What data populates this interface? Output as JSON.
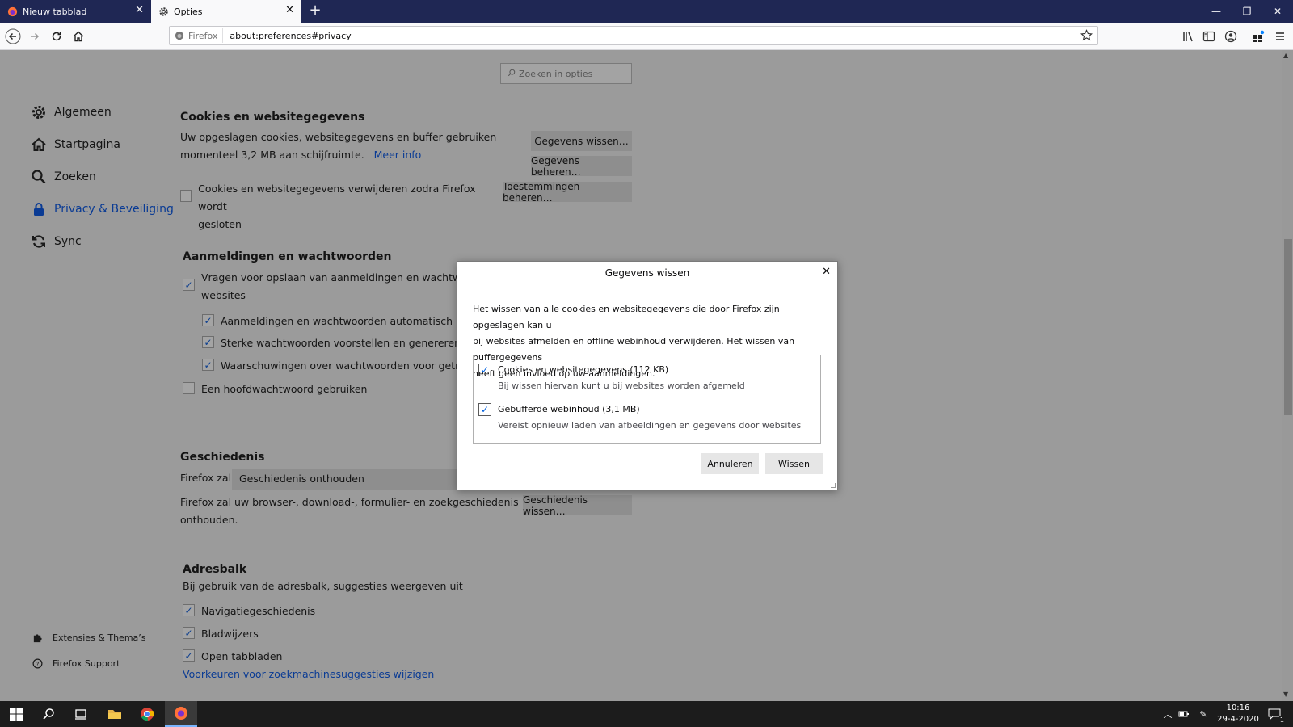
{
  "browser": {
    "tabs": [
      {
        "label": "Nieuw tabblad",
        "icon": "firefox-icon"
      },
      {
        "label": "Opties",
        "icon": "gear-icon"
      }
    ],
    "url_identity": "Firefox",
    "url": "about:preferences#privacy"
  },
  "sidebar": {
    "items": [
      {
        "label": "Algemeen",
        "icon": "gear-icon"
      },
      {
        "label": "Startpagina",
        "icon": "home-icon"
      },
      {
        "label": "Zoeken",
        "icon": "search-icon"
      },
      {
        "label": "Privacy & Beveiliging",
        "icon": "lock-icon",
        "active": true
      },
      {
        "label": "Sync",
        "icon": "sync-icon"
      }
    ],
    "footer": [
      {
        "label": "Extensies & Thema’s",
        "icon": "puzzle-icon"
      },
      {
        "label": "Firefox Support",
        "icon": "help-icon"
      }
    ]
  },
  "search": {
    "placeholder": "Zoeken in opties"
  },
  "cookies": {
    "title": "Cookies en websitegegevens",
    "desc_line1": "Uw opgeslagen cookies, websitegegevens en buffer gebruiken",
    "desc_line2": "momenteel 3,2 MB aan schijfruimte.",
    "more_info": "Meer info",
    "btn_clear": "Gegevens wissen…",
    "btn_manage": "Gegevens beheren…",
    "btn_permissions": "Toestemmingen beheren…",
    "delete_on_close_line1": "Cookies en websitegegevens verwijderen zodra Firefox wordt",
    "delete_on_close_line2": "gesloten"
  },
  "logins": {
    "title": "Aanmeldingen en wachtwoorden",
    "ask_save_line1": "Vragen voor opslaan van aanmeldingen en wachtwoorden",
    "ask_save_line2": "websites",
    "autofill": "Aanmeldingen en wachtwoorden automatisch invulle",
    "suggest": "Sterke wachtwoorden voorstellen en genereren",
    "breach": "Waarschuwingen over wachtwoorden voor getroffen",
    "master": "Een hoofdwachtwoord gebruiken"
  },
  "history": {
    "title": "Geschiedenis",
    "firefox_will": "Firefox zal",
    "mode": "Geschiedenis onthouden",
    "desc_line1": "Firefox zal uw browser-, download-, formulier- en zoekgeschiedenis",
    "desc_line2": "onthouden.",
    "btn_clear": "Geschiedenis wissen…"
  },
  "addressbar": {
    "title": "Adresbalk",
    "desc": "Bij gebruik van de adresbalk, suggesties weergeven uit",
    "items": [
      "Navigatiegeschiedenis",
      "Bladwijzers",
      "Open tabbladen"
    ],
    "link": "Voorkeuren voor zoekmachinesuggesties wijzigen"
  },
  "dialog": {
    "title": "Gegevens wissen",
    "desc_line1": "Het wissen van alle cookies en websitegegevens die door Firefox zijn opgeslagen kan u",
    "desc_line2": "bij websites afmelden en offline webinhoud verwijderen. Het wissen van buffergegevens",
    "desc_line3": "heeft geen invloed op uw aanmeldingen.",
    "option1_label": "Cookies en websitegegevens (112 KB)",
    "option1_sub": "Bij wissen hiervan kunt u bij websites worden afgemeld",
    "option2_label": "Gebufferde webinhoud (3,1 MB)",
    "option2_sub": "Vereist opnieuw laden van afbeeldingen en gegevens door websites",
    "cancel": "Annuleren",
    "clear": "Wissen"
  },
  "taskbar": {
    "time": "10:16",
    "date": "29-4-2020",
    "notification_count": "1"
  }
}
